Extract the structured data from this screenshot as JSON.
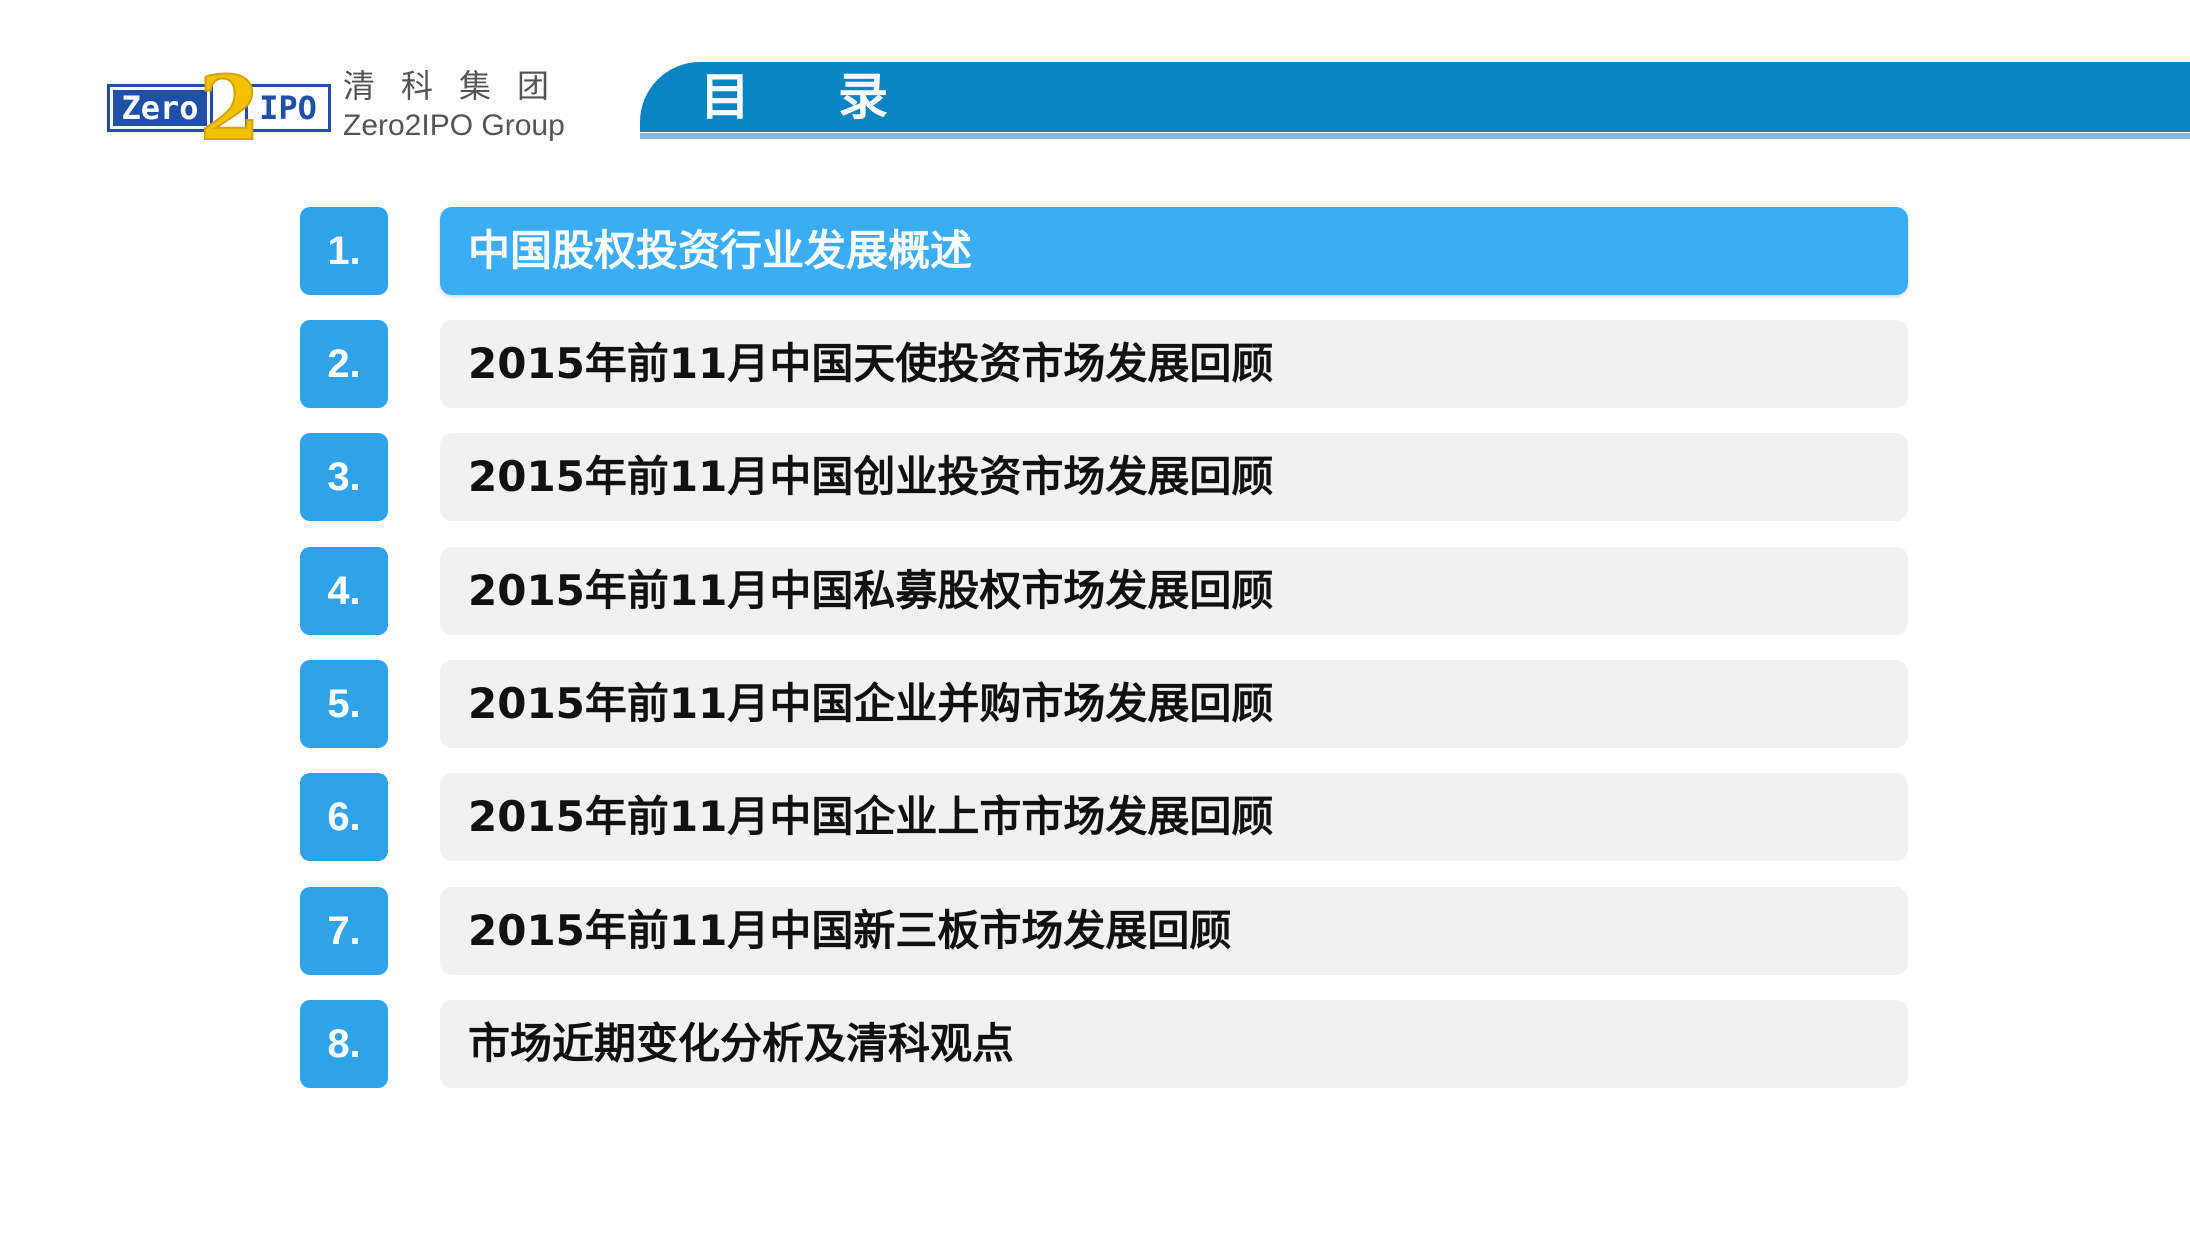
{
  "logo": {
    "mark_left": "Zero",
    "mark_digit": "2",
    "mark_right": "IPO",
    "cn_name": "清科集团",
    "en_name": "Zero2IPO Group",
    "colors": {
      "blue": "#1f4fa6",
      "gold": "#f2c200"
    }
  },
  "header": {
    "title": "目录",
    "band_color": "#0a84c3"
  },
  "toc": {
    "items": [
      {
        "number": "1.",
        "label": "中国股权投资行业发展概述",
        "active": true
      },
      {
        "number": "2.",
        "label": "2015年前11月中国天使投资市场发展回顾",
        "active": false
      },
      {
        "number": "3.",
        "label": "2015年前11月中国创业投资市场发展回顾",
        "active": false
      },
      {
        "number": "4.",
        "label": "2015年前11月中国私募股权市场发展回顾",
        "active": false
      },
      {
        "number": "5.",
        "label": "2015年前11月中国企业并购市场发展回顾",
        "active": false
      },
      {
        "number": "6.",
        "label": "2015年前11月中国企业上市市场发展回顾",
        "active": false
      },
      {
        "number": "7.",
        "label": "2015年前11月中国新三板市场发展回顾",
        "active": false
      },
      {
        "number": "8.",
        "label": "市场近期变化分析及清科观点",
        "active": false
      }
    ],
    "colors": {
      "number_bg": "#2ea3ea",
      "active_bg": "#3aadf4",
      "inactive_bg": "#f1f1f1"
    }
  }
}
